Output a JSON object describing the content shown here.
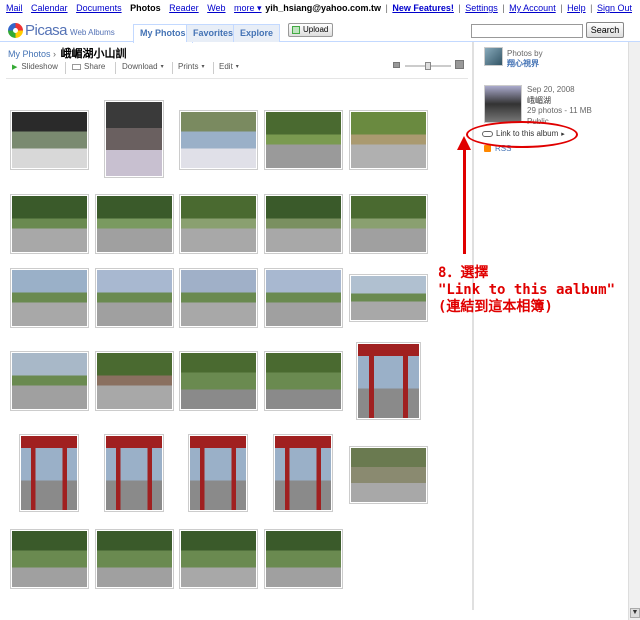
{
  "top_nav": {
    "links": [
      "Mail",
      "Calendar",
      "Documents",
      "Photos",
      "Reader",
      "Web",
      "more ▾"
    ],
    "current": "Photos"
  },
  "account": {
    "email": "yih_hsiang@yahoo.com.tw",
    "links": [
      "New Features!",
      "Settings",
      "My Account",
      "Help",
      "Sign Out"
    ],
    "separator": "|"
  },
  "header": {
    "brand": "Picasa",
    "brand_sub": "Web Albums",
    "tabs": [
      "My Photos",
      "Favorites",
      "Explore"
    ],
    "active_tab": "My Photos",
    "upload_label": "Upload",
    "search_placeholder": "",
    "search_button": "Search"
  },
  "breadcrumb": {
    "root": "My Photos",
    "arrow": "›",
    "album_title": "峨嵋湖小山訓"
  },
  "toolbar": {
    "slideshow": "Slideshow",
    "share": "Share",
    "download": "Download",
    "prints": "Prints",
    "edit": "Edit",
    "dropdown_glyph": "▾",
    "play_glyph": "▶"
  },
  "sidebar": {
    "photos_by_label": "Photos by",
    "owner": "翔心視界",
    "album_date": "Sep 20, 2008",
    "album_name": "峨嵋湖",
    "album_count": "29 photos - 11 MB",
    "album_visibility": "Public",
    "link_label": "Link to this album",
    "link_arrow": "▸",
    "rss_label": "RSS"
  },
  "annotation": {
    "line1": "8．選擇",
    "line2": "\"Link to this aalbum\"",
    "line3": "(連結到這本相簿)",
    "color": "#e00000"
  },
  "photos": [
    {
      "label": "photo-01",
      "scene": "bike computer",
      "colors": [
        "#2a2a2a",
        "#7a8a70",
        "#d8d8d8"
      ]
    },
    {
      "label": "photo-02",
      "scene": "rider",
      "colors": [
        "#3a3a3a",
        "#6a6060",
        "#c8c0d0"
      ]
    },
    {
      "label": "photo-03",
      "scene": "rider selfie",
      "colors": [
        "#7a8a60",
        "#9ab0c8",
        "#e0e0e8"
      ]
    },
    {
      "label": "photo-04",
      "scene": "road",
      "colors": [
        "#4a6a30",
        "#7a9a50",
        "#9a9a9a"
      ]
    },
    {
      "label": "photo-05",
      "scene": "road",
      "colors": [
        "#6a8a40",
        "#aa9a70",
        "#b0b0b0"
      ]
    },
    {
      "label": "photo-06",
      "scene": "road",
      "colors": [
        "#3a5a2a",
        "#6a8a50",
        "#a8a8a8"
      ]
    },
    {
      "label": "photo-07",
      "scene": "road",
      "colors": [
        "#3a5a2a",
        "#7a9a60",
        "#a0a0a0"
      ]
    },
    {
      "label": "photo-08",
      "scene": "road",
      "colors": [
        "#4a6a30",
        "#8aa070",
        "#a8a8a8"
      ]
    },
    {
      "label": "photo-09",
      "scene": "road",
      "colors": [
        "#3a5a2a",
        "#7a9060",
        "#a8a8a8"
      ]
    },
    {
      "label": "photo-10",
      "scene": "road",
      "colors": [
        "#4a6a30",
        "#8aa070",
        "#a0a0a0"
      ]
    },
    {
      "label": "photo-11",
      "scene": "road",
      "colors": [
        "#9ab0c8",
        "#6a8a50",
        "#a8a8a8"
      ]
    },
    {
      "label": "photo-12",
      "scene": "road",
      "colors": [
        "#a8b8d0",
        "#6a8a50",
        "#a0a0a0"
      ]
    },
    {
      "label": "photo-13",
      "scene": "road",
      "colors": [
        "#a0b0c8",
        "#6a8a50",
        "#a8a8a8"
      ]
    },
    {
      "label": "photo-14",
      "scene": "road",
      "colors": [
        "#a8b8d0",
        "#6a8a50",
        "#a0a0a0"
      ]
    },
    {
      "label": "photo-15",
      "scene": "road",
      "colors": [
        "#b0c0d0",
        "#6a8a50",
        "#a8a8a8"
      ]
    },
    {
      "label": "photo-16",
      "scene": "road",
      "colors": [
        "#a8b8c8",
        "#6a8a50",
        "#a0a0a0"
      ]
    },
    {
      "label": "photo-17",
      "scene": "road",
      "colors": [
        "#4a6a30",
        "#8a7060",
        "#a8a8a8"
      ]
    },
    {
      "label": "photo-18",
      "scene": "group",
      "colors": [
        "#4a6a30",
        "#6a8a50",
        "#8a8a8a"
      ]
    },
    {
      "label": "photo-19",
      "scene": "group",
      "colors": [
        "#4a6a30",
        "#6a8a50",
        "#8a8a8a"
      ]
    },
    {
      "label": "photo-20",
      "scene": "gate",
      "colors": [
        "#a02020",
        "#9ab0c8",
        "#8a8a8a"
      ]
    },
    {
      "label": "photo-21",
      "scene": "gate",
      "colors": [
        "#a02020",
        "#9ab0c8",
        "#8a8a8a"
      ]
    },
    {
      "label": "photo-22",
      "scene": "gate",
      "colors": [
        "#a02020",
        "#9ab0c8",
        "#8a8a8a"
      ]
    },
    {
      "label": "photo-23",
      "scene": "gate",
      "colors": [
        "#a02020",
        "#9ab0c8",
        "#8a8a8a"
      ]
    },
    {
      "label": "photo-24",
      "scene": "gate",
      "colors": [
        "#a02020",
        "#9ab0c8",
        "#8a8a8a"
      ]
    },
    {
      "label": "photo-25",
      "scene": "rider",
      "colors": [
        "#6a7a50",
        "#8a8a70",
        "#a8a8a8"
      ]
    },
    {
      "label": "photo-26",
      "scene": "rider",
      "colors": [
        "#3a5a2a",
        "#6a8a50",
        "#a0a0a0"
      ]
    },
    {
      "label": "photo-27",
      "scene": "rider",
      "colors": [
        "#3a5a2a",
        "#6a8a50",
        "#a0a0a0"
      ]
    },
    {
      "label": "photo-28",
      "scene": "rider",
      "colors": [
        "#3a5a2a",
        "#6a8a50",
        "#a8a8a8"
      ]
    },
    {
      "label": "photo-29",
      "scene": "rider",
      "colors": [
        "#3a5a2a",
        "#6a8a50",
        "#a0a0a0"
      ]
    }
  ]
}
